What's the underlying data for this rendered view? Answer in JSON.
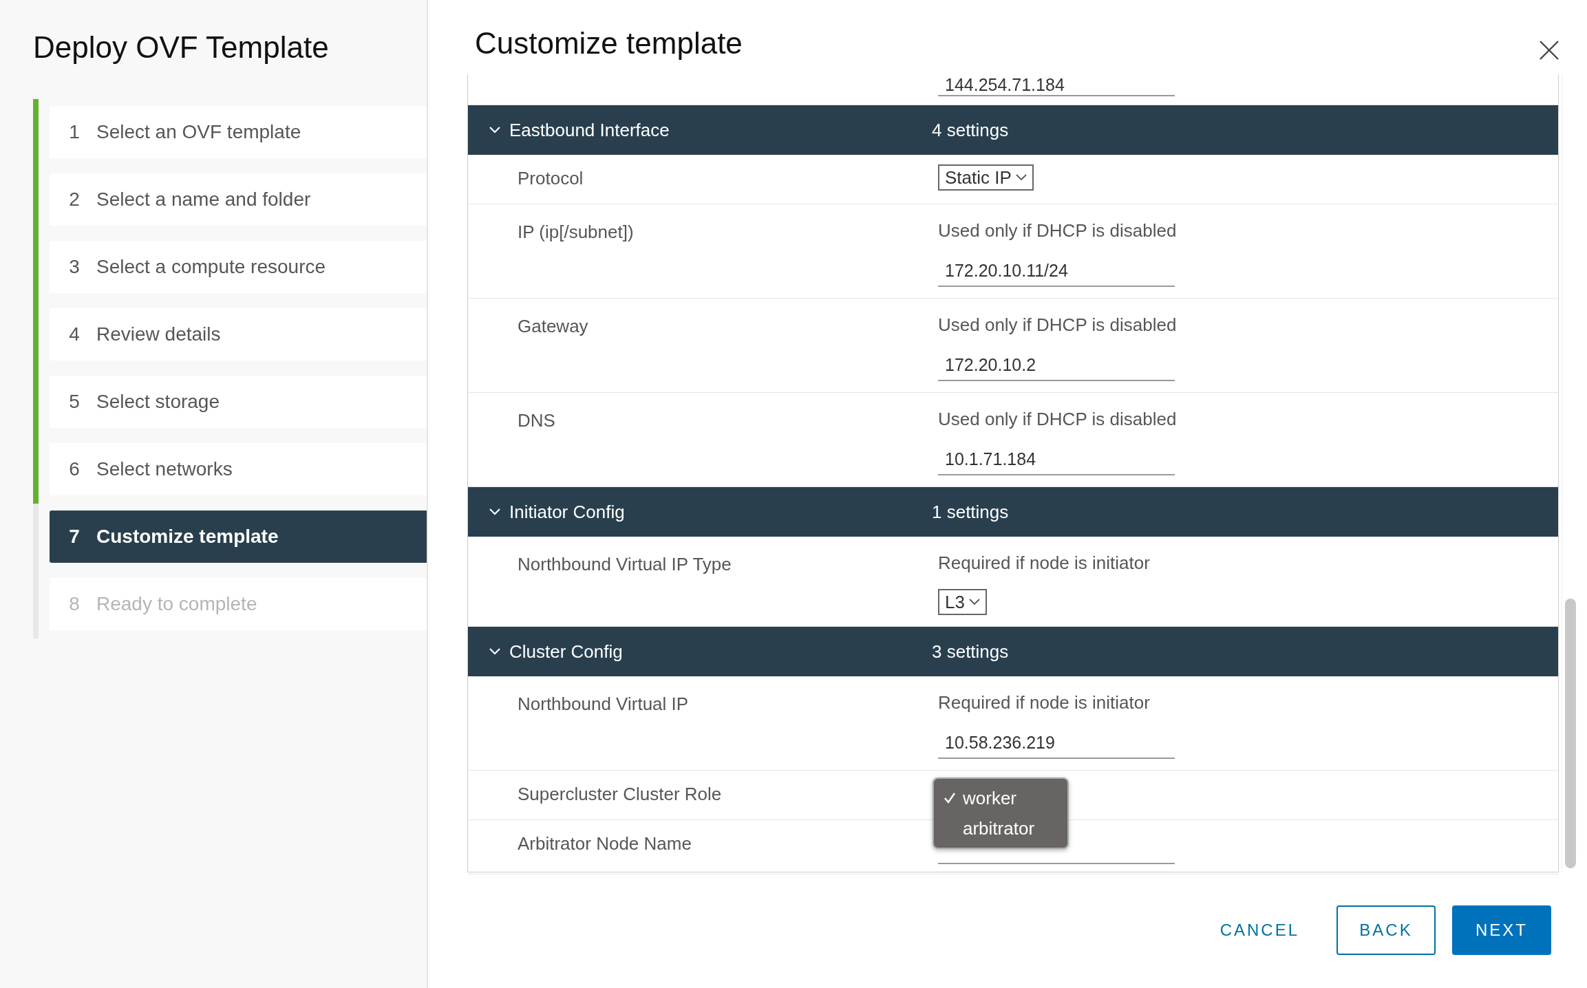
{
  "sidebar": {
    "title": "Deploy OVF Template",
    "steps": [
      {
        "number": "1",
        "label": "Select an OVF template",
        "completed": true,
        "selected": false,
        "disabled": false
      },
      {
        "number": "2",
        "label": "Select a name and folder",
        "completed": true,
        "selected": false,
        "disabled": false
      },
      {
        "number": "3",
        "label": "Select a compute resource",
        "completed": true,
        "selected": false,
        "disabled": false
      },
      {
        "number": "4",
        "label": "Review details",
        "completed": true,
        "selected": false,
        "disabled": false
      },
      {
        "number": "5",
        "label": "Select storage",
        "completed": true,
        "selected": false,
        "disabled": false
      },
      {
        "number": "6",
        "label": "Select networks",
        "completed": true,
        "selected": false,
        "disabled": false
      },
      {
        "number": "7",
        "label": "Customize template",
        "completed": false,
        "selected": true,
        "disabled": false
      },
      {
        "number": "8",
        "label": "Ready to complete",
        "completed": false,
        "selected": false,
        "disabled": true
      }
    ]
  },
  "main": {
    "title": "Customize template",
    "partial_field": {
      "value": "144.254.71.184"
    },
    "sections": [
      {
        "title": "Eastbound Interface",
        "count": "4 settings",
        "expanded": true,
        "settings": [
          {
            "label": "Protocol",
            "control": {
              "kind": "select",
              "value": "Static IP"
            }
          },
          {
            "label": "IP (ip[/subnet])",
            "hint": "Used only if DHCP is disabled",
            "control": {
              "kind": "text",
              "value": "172.20.10.11/24"
            }
          },
          {
            "label": "Gateway",
            "hint": "Used only if DHCP is disabled",
            "control": {
              "kind": "text",
              "value": "172.20.10.2"
            }
          },
          {
            "label": "DNS",
            "hint": "Used only if DHCP is disabled",
            "control": {
              "kind": "text",
              "value": "10.1.71.184"
            }
          }
        ]
      },
      {
        "title": "Initiator Config",
        "count": "1 settings",
        "expanded": true,
        "settings": [
          {
            "label": "Northbound Virtual IP Type",
            "hint": "Required if node is initiator",
            "control": {
              "kind": "select",
              "value": "L3"
            }
          }
        ]
      },
      {
        "title": "Cluster Config",
        "count": "3 settings",
        "expanded": true,
        "settings": [
          {
            "label": "Northbound Virtual IP",
            "hint": "Required if node is initiator",
            "control": {
              "kind": "text",
              "value": "10.58.236.219"
            }
          },
          {
            "label": "Supercluster Cluster Role",
            "control": {
              "kind": "menu",
              "options": [
                {
                  "label": "worker",
                  "selected": true
                },
                {
                  "label": "arbitrator",
                  "selected": false
                }
              ]
            }
          },
          {
            "label": "Arbitrator Node Name",
            "control": {
              "kind": "text"
            }
          }
        ]
      }
    ]
  },
  "buttons": [
    {
      "label": "CANCEL",
      "kind": "flat"
    },
    {
      "label": "BACK",
      "kind": "outline"
    },
    {
      "label": "NEXT",
      "kind": "primary"
    }
  ]
}
